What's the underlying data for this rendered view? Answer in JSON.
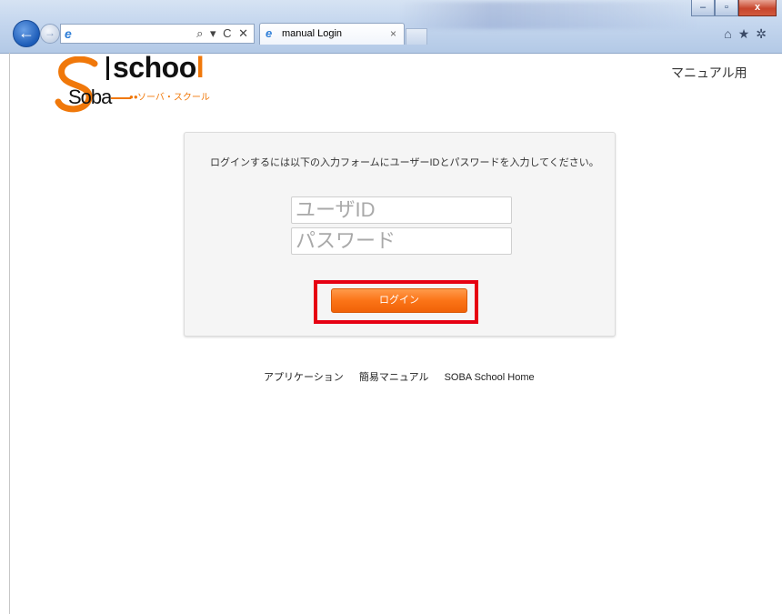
{
  "browser": {
    "tab_title": "manual Login",
    "tab_close": "×",
    "back_glyph": "←",
    "forward_glyph": "→",
    "addr_tools": "⌕ ▾ C ✕",
    "win_minimize": "–",
    "win_restore": "▫",
    "win_close": "x",
    "right_icons": "⌂★✲"
  },
  "header": {
    "logo_school_main": "schoo",
    "logo_school_l": "l",
    "logo_soba": "Soba",
    "logo_kana": "ソーバ・スクール",
    "manual_label": "マニュアル用"
  },
  "login": {
    "instruction": "ログインするには以下の入力フォームにユーザーIDとパスワードを入力してください。",
    "user_placeholder": "ユーザID",
    "password_placeholder": "パスワード",
    "login_label": "ログイン"
  },
  "footer": {
    "links": [
      "アプリケーション",
      "簡易マニュアル",
      "SOBA School Home"
    ]
  },
  "colors": {
    "accent": "#f0780a",
    "highlight": "#e60012"
  }
}
